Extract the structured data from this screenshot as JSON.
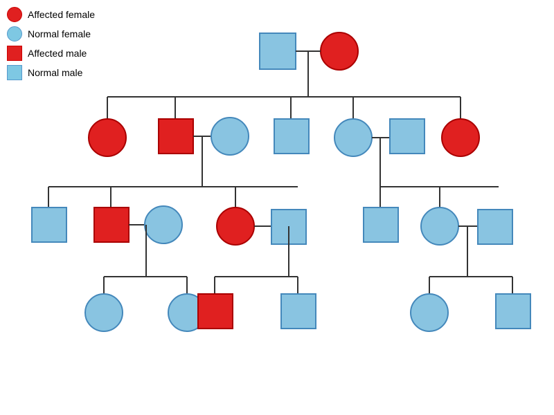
{
  "legend": {
    "items": [
      {
        "label": "Affected female",
        "shape": "circle",
        "type": "affected"
      },
      {
        "label": "Normal female",
        "shape": "circle",
        "type": "normal"
      },
      {
        "label": "Affected male",
        "shape": "square",
        "type": "affected"
      },
      {
        "label": "Normal male",
        "shape": "square",
        "type": "normal"
      }
    ]
  },
  "colors": {
    "affected": "#e02020",
    "normal": "#89c4e1",
    "line": "#333",
    "border_affected": "#aa0000",
    "border_normal": "#4488bb"
  }
}
